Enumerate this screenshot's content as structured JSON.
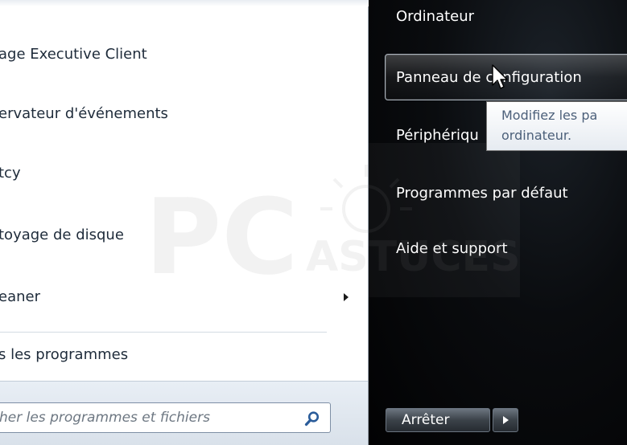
{
  "left_panel": {
    "programs": [
      {
        "label": "age Executive Client",
        "has_submenu": false
      },
      {
        "label": "ervateur d'événements",
        "has_submenu": false
      },
      {
        "label": "tcy",
        "has_submenu": false
      },
      {
        "label": "toyage de disque",
        "has_submenu": false
      },
      {
        "label": "eaner",
        "has_submenu": true
      }
    ],
    "all_programs_label": "s les programmes",
    "search": {
      "placeholder": "her les programmes et fichiers",
      "icon": "search-icon"
    }
  },
  "right_panel": {
    "items": [
      {
        "label": "Ordinateur"
      },
      {
        "label": "Panneau de configuration",
        "highlighted": true
      },
      {
        "label": "Périphériqu"
      },
      {
        "label": "Programmes par défaut"
      },
      {
        "label": "Aide et support"
      }
    ],
    "tooltip": {
      "line1": "Modifiez les pa",
      "line2": "ordinateur."
    },
    "shutdown": {
      "label": "Arrêter",
      "arrow_icon": "arrow-right-icon"
    }
  },
  "watermark": {
    "text_pc": "PC",
    "text_astuces": "ASTUCES"
  },
  "colors": {
    "left_bg": "#ffffff",
    "right_bg": "#050608",
    "text_dark": "#1e2b3a",
    "tooltip_text": "#4c607a"
  }
}
